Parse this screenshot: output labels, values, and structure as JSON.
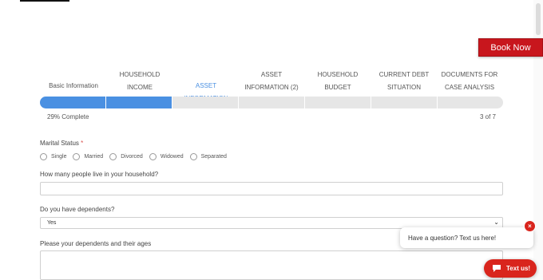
{
  "header": {
    "book_now": "Book Now"
  },
  "steps": [
    {
      "label": "Basic Information",
      "active": false
    },
    {
      "label": "HOUSEHOLD INCOME INFORMATION",
      "active": false
    },
    {
      "label": "ASSET INFORMATION",
      "active": true
    },
    {
      "label": "ASSET INFORMATION (2)",
      "active": false
    },
    {
      "label": "HOUSEHOLD BUDGET INFORMATION",
      "active": false
    },
    {
      "label": "CURRENT DEBT SITUATION",
      "active": false
    },
    {
      "label": "DOCUMENTS FOR CASE ANALYSIS",
      "active": false
    }
  ],
  "progress": {
    "percent": 29,
    "percent_label": "29% Complete",
    "pages_label": "3 of 7"
  },
  "form": {
    "marital_status": {
      "label": "Marital Status",
      "required_mark": "*",
      "options": [
        "Single",
        "Married",
        "Divorced",
        "Widowed",
        "Separated"
      ]
    },
    "household_people": {
      "label": "How many people live in your household?",
      "value": ""
    },
    "dependents": {
      "label": "Do you have dependents?",
      "selected": "Yes"
    },
    "dependents_ages": {
      "label": "Please your dependents and their ages",
      "value": ""
    }
  },
  "chat": {
    "bubble_text": "Have a question? Text us here!",
    "close_symbol": "×",
    "text_us": "Text us!"
  },
  "colors": {
    "accent": "#4a90e2",
    "brand_red": "#c8161d",
    "chat_red": "#d9251d"
  }
}
